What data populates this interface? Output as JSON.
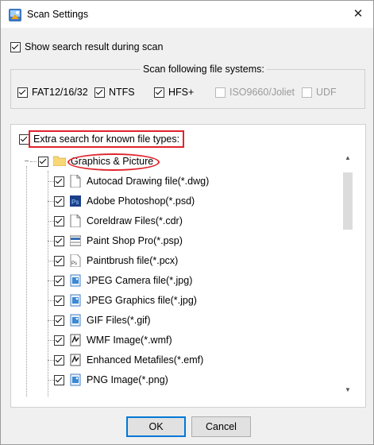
{
  "window": {
    "title": "Scan Settings",
    "close_glyph": "✕"
  },
  "options": {
    "show_results_label": "Show search result during scan",
    "show_results_checked": true
  },
  "file_systems": {
    "caption": "Scan following file systems:",
    "items": [
      {
        "label": "FAT12/16/32",
        "checked": true,
        "enabled": true
      },
      {
        "label": "NTFS",
        "checked": true,
        "enabled": true
      },
      {
        "label": "HFS+",
        "checked": true,
        "enabled": true
      },
      {
        "label": "ISO9660/Joliet",
        "checked": false,
        "enabled": false
      },
      {
        "label": "UDF",
        "checked": false,
        "enabled": false
      }
    ]
  },
  "file_types": {
    "extra_search_label": "Extra search for known file types:",
    "extra_search_checked": true,
    "group": {
      "label": "Graphics & Picture",
      "checked": true,
      "expander": "−"
    },
    "items": [
      {
        "label": "Autocad Drawing file(*.dwg)",
        "icon": "blank-document-icon"
      },
      {
        "label": "Adobe Photoshop(*.psd)",
        "icon": "photoshop-icon"
      },
      {
        "label": "Coreldraw Files(*.cdr)",
        "icon": "blank-document-icon"
      },
      {
        "label": "Paint Shop Pro(*.psp)",
        "icon": "paintshop-icon"
      },
      {
        "label": "Paintbrush file(*.pcx)",
        "icon": "ps-document-icon"
      },
      {
        "label": "JPEG Camera file(*.jpg)",
        "icon": "image-file-icon"
      },
      {
        "label": "JPEG Graphics file(*.jpg)",
        "icon": "image-file-icon"
      },
      {
        "label": "GIF Files(*.gif)",
        "icon": "image-file-icon"
      },
      {
        "label": "WMF Image(*.wmf)",
        "icon": "metafile-icon"
      },
      {
        "label": "Enhanced Metafiles(*.emf)",
        "icon": "metafile-icon"
      },
      {
        "label": "PNG Image(*.png)",
        "icon": "image-file-icon"
      }
    ]
  },
  "buttons": {
    "ok": "OK",
    "cancel": "Cancel"
  },
  "colors": {
    "highlight": "#e0242c",
    "accent": "#0078d7"
  }
}
